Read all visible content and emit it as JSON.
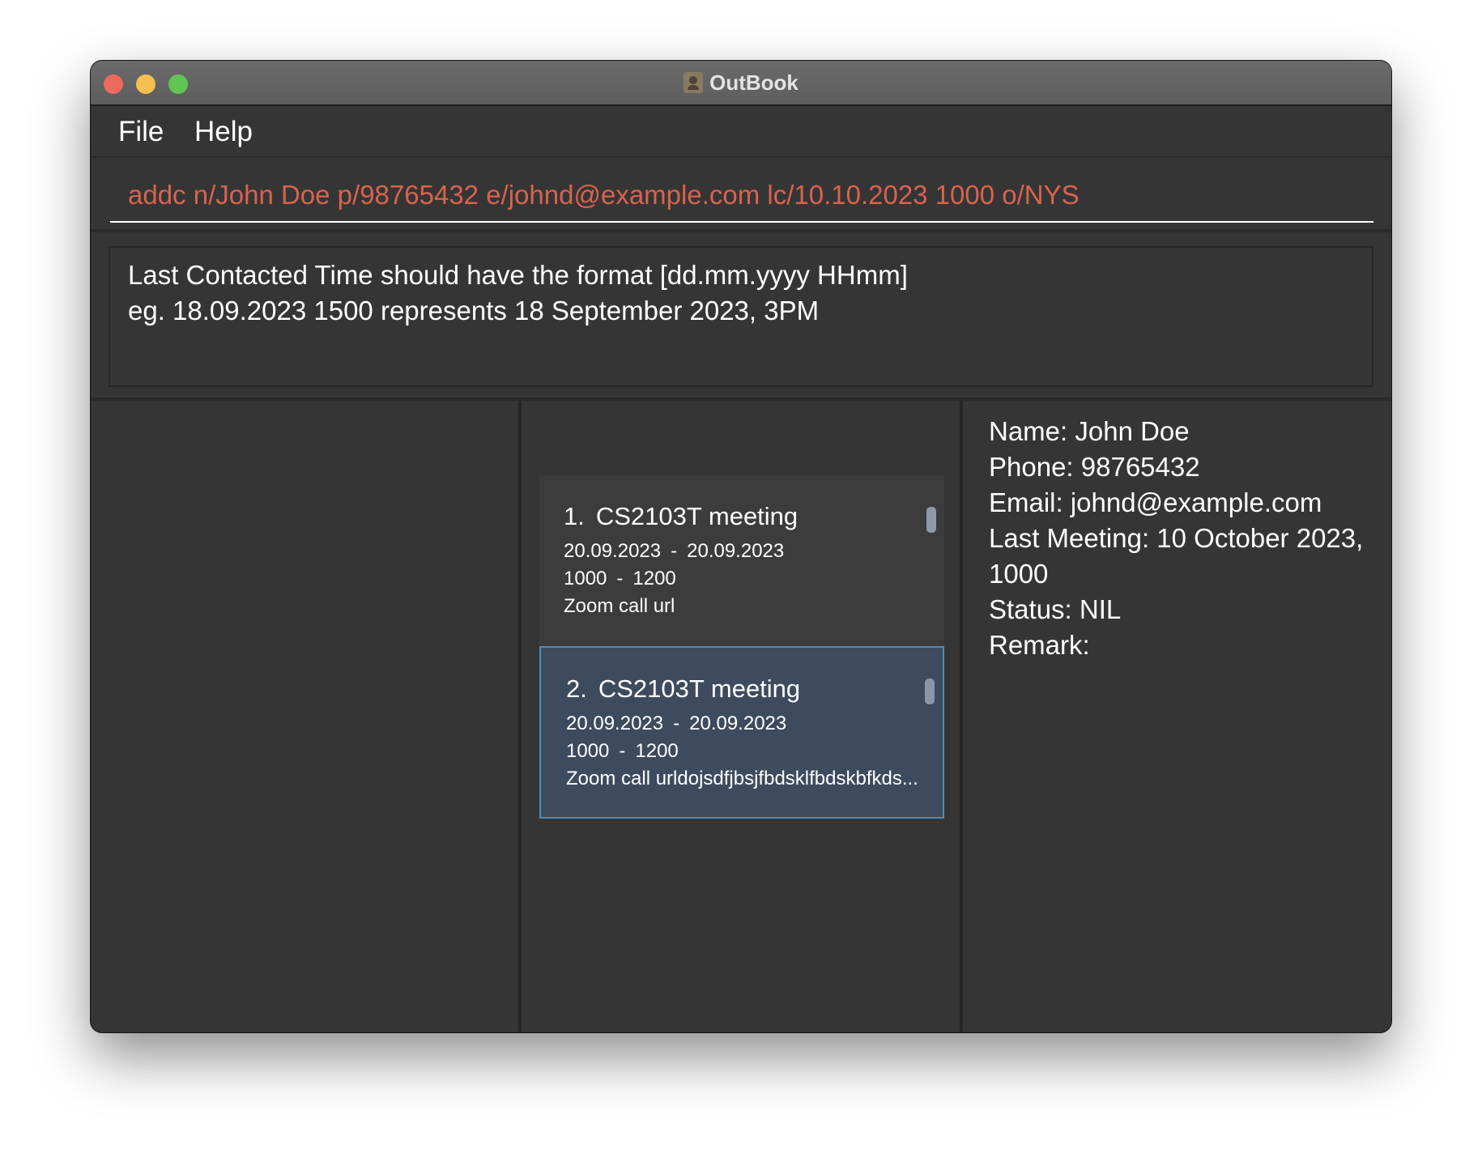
{
  "window": {
    "title": "OutBook"
  },
  "menu": {
    "file": "File",
    "help": "Help"
  },
  "command": {
    "value": "addc n/John Doe p/98765432 e/johnd@example.com lc/10.10.2023 1000 o/NYS"
  },
  "result": {
    "line1": "Last Contacted Time should have the format [dd.mm.yyyy HHmm]",
    "line2": "eg. 18.09.2023 1500 represents 18 September 2023, 3PM"
  },
  "meetings": [
    {
      "index": "1.",
      "title": "CS2103T meeting",
      "start_date": "20.09.2023",
      "end_date": "20.09.2023",
      "start_time": "1000",
      "end_time": "1200",
      "location": "Zoom call url",
      "separator": "-"
    },
    {
      "index": "2.",
      "title": "CS2103T meeting",
      "start_date": "20.09.2023",
      "end_date": "20.09.2023",
      "start_time": "1000",
      "end_time": "1200",
      "location": "Zoom call urldojsdfjbsjfbdsklfbdskbfkds...",
      "separator": "-"
    }
  ],
  "details": {
    "name": "Name: John Doe",
    "phone": "Phone: 98765432",
    "email": "Email: johnd@example.com",
    "last_meeting": "Last Meeting: 10 October 2023, 1000",
    "status": "Status: NIL",
    "remark": "Remark:"
  },
  "colors": {
    "background": "#353535",
    "command_text": "#d9634d",
    "selected_card": "#3e4a5e",
    "selected_border": "#4e8dbb"
  }
}
